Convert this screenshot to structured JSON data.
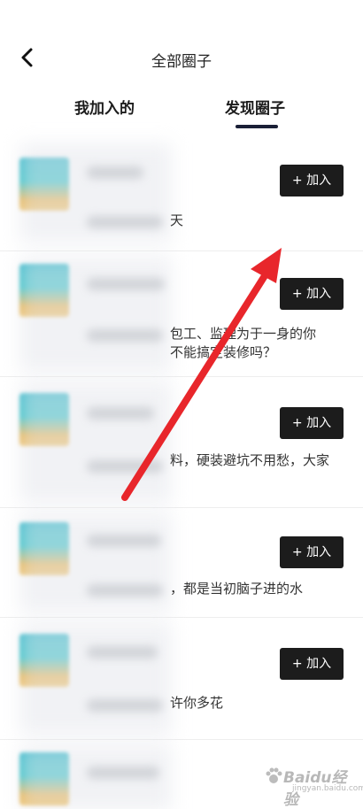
{
  "header": {
    "title": "全部圈子",
    "back_icon": "chevron-left-icon"
  },
  "tabs": [
    {
      "label": "我加入的",
      "active": false
    },
    {
      "label": "发现圈子",
      "active": true
    }
  ],
  "circles": [
    {
      "desc_lines": [
        "天"
      ],
      "join_label": "+ 加入"
    },
    {
      "desc_lines": [
        "包工、监理为于一身的你",
        "不能搞定装修吗？"
      ],
      "join_label": "+ 加入"
    },
    {
      "desc_lines": [
        "料，硬装避坑不用愁，大家"
      ],
      "join_label": "+ 加入"
    },
    {
      "desc_lines": [
        "，都是当初脑子进的水"
      ],
      "join_label": "+ 加入"
    },
    {
      "desc_lines": [
        "许你多花"
      ],
      "join_label": "+ 加入"
    },
    {
      "desc_lines": [],
      "join_label": ""
    }
  ],
  "annotation": {
    "type": "red-arrow",
    "color": "#e8262b"
  },
  "watermark": {
    "text": "Baidu经验",
    "sub": "jingyan.baidu.com"
  }
}
